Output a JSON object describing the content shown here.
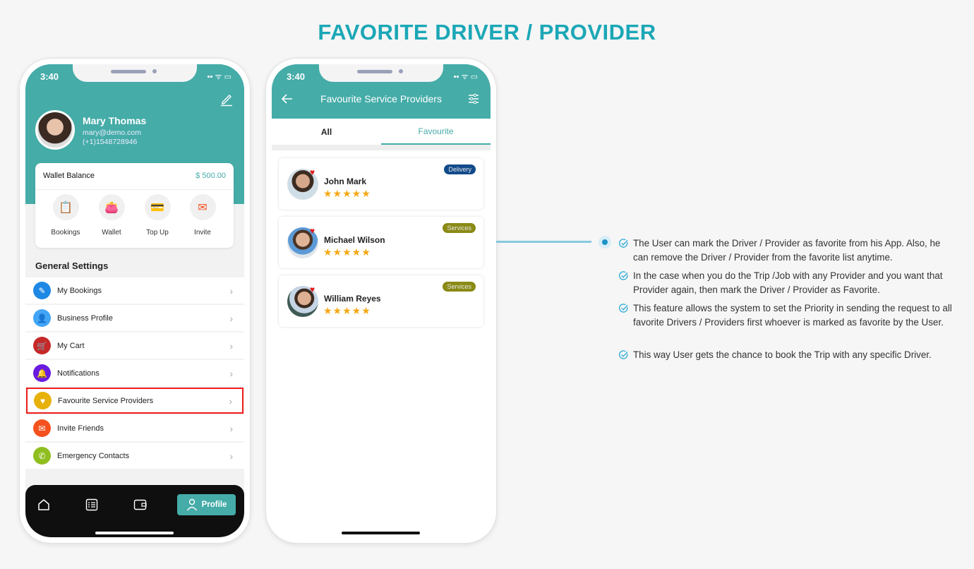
{
  "page_title": "FAVORITE DRIVER / PROVIDER",
  "accent": "#45aca8",
  "title_color": "#1ba7b6",
  "status_time": "3:40",
  "profile_screen": {
    "user": {
      "name": "Mary Thomas",
      "email": "mary@demo.com",
      "phone": "(+1)1548728946"
    },
    "wallet": {
      "label": "Wallet Balance",
      "amount": "$ 500.00"
    },
    "quick_actions": [
      {
        "label": "Bookings",
        "icon": "bookings-icon"
      },
      {
        "label": "Wallet",
        "icon": "wallet-icon"
      },
      {
        "label": "Top Up",
        "icon": "top-up-icon"
      },
      {
        "label": "Invite",
        "icon": "invite-icon"
      }
    ],
    "section_title": "General Settings",
    "menu": [
      {
        "label": "My Bookings",
        "icon": "bookings-icon",
        "color": "#1e88e5"
      },
      {
        "label": "Business Profile",
        "icon": "business-profile-icon",
        "color": "#42a5f5"
      },
      {
        "label": "My Cart",
        "icon": "cart-icon",
        "color": "#c62828"
      },
      {
        "label": "Notifications",
        "icon": "bell-icon",
        "color": "#6a1be0"
      },
      {
        "label": "Favourite Service Providers",
        "icon": "heart-icon",
        "color": "#e7b10a",
        "highlighted": true
      },
      {
        "label": "Invite Friends",
        "icon": "invite-icon",
        "color": "#f4511e"
      },
      {
        "label": "Emergency Contacts",
        "icon": "phone-icon",
        "color": "#8fbe1f"
      }
    ],
    "bottom_nav": {
      "items": [
        "home-icon",
        "bookings-list-icon",
        "wallet-icon"
      ],
      "active_label": "Profile"
    }
  },
  "favourites_screen": {
    "title": "Favourite Service Providers",
    "tabs": [
      {
        "label": "All",
        "active": false
      },
      {
        "label": "Favourite",
        "active": true
      }
    ],
    "providers": [
      {
        "name": "John Mark",
        "rating": 5,
        "badge": "Delivery",
        "badge_color": "#114a8a"
      },
      {
        "name": "Michael Wilson",
        "rating": 5,
        "badge": "Services",
        "badge_color": "#8a8a16"
      },
      {
        "name": "William Reyes",
        "rating": 5,
        "badge": "Services",
        "badge_color": "#8a8a16"
      }
    ]
  },
  "features": [
    "The User can mark the Driver / Provider as favorite from his App. Also, he can remove the Driver / Provider from the favorite list anytime.",
    "In the case when you do the Trip /Job with any Provider and you want that Provider again, then mark the Driver / Provider as Favorite.",
    "This feature allows the system to set the Priority in sending the request to all favorite Drivers / Providers first whoever is marked as favorite by the User.",
    "This way User gets the chance to book the Trip with any specific Driver."
  ]
}
